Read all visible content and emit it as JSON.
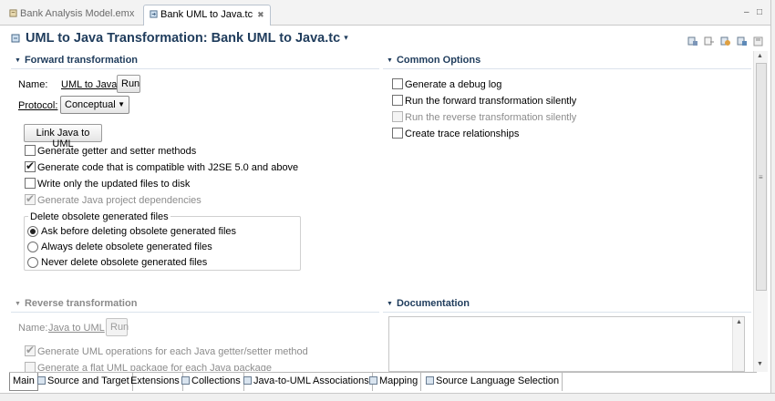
{
  "editor_tabs": [
    {
      "label": "Bank Analysis Model.emx",
      "active": false
    },
    {
      "label": "Bank UML to Java.tc",
      "active": true,
      "close": "✖"
    }
  ],
  "window_controls": {
    "minimize": "‒",
    "maximize": "□"
  },
  "header": {
    "title": "UML to Java Transformation: Bank UML to Java.tc",
    "menu_caret": "▾"
  },
  "forward": {
    "title": "Forward transformation",
    "name_label": "Name:",
    "name_value": "UML to Java",
    "run_label": "Run",
    "protocol_label": "Protocol:",
    "protocol_value": "Conceptual",
    "link_button": "Link Java to UML",
    "options": [
      {
        "label": "Generate getter and setter methods",
        "checked": false,
        "enabled": true
      },
      {
        "label": "Generate code that is compatible with J2SE 5.0 and above",
        "checked": true,
        "enabled": true
      },
      {
        "label": "Write only the updated files to disk",
        "checked": false,
        "enabled": true
      },
      {
        "label": "Generate Java project dependencies",
        "checked": true,
        "enabled": false
      }
    ],
    "delete_group": {
      "title": "Delete obsolete generated files",
      "options": [
        {
          "label": "Ask before deleting obsolete generated files",
          "selected": true
        },
        {
          "label": "Always delete obsolete generated files",
          "selected": false
        },
        {
          "label": "Never delete obsolete generated files",
          "selected": false
        }
      ]
    }
  },
  "common": {
    "title": "Common Options",
    "options": [
      {
        "label": "Generate a debug log",
        "checked": false,
        "enabled": true
      },
      {
        "label": "Run the forward transformation silently",
        "checked": false,
        "enabled": true
      },
      {
        "label": "Run the reverse transformation silently",
        "checked": false,
        "enabled": false
      },
      {
        "label": "Create trace relationships",
        "checked": false,
        "enabled": true
      }
    ]
  },
  "reverse": {
    "title": "Reverse transformation",
    "name_label": "Name:",
    "name_value": "Java to UML",
    "run_label": "Run",
    "options": [
      {
        "label": "Generate UML operations for each Java getter/setter method",
        "checked": true,
        "enabled": false
      },
      {
        "label": "Generate a flat UML package for each Java package",
        "checked": false,
        "enabled": false
      }
    ]
  },
  "documentation": {
    "title": "Documentation",
    "value": ""
  },
  "page_tabs": [
    {
      "label": "Main",
      "active": true,
      "icon": false
    },
    {
      "label": "Source and Target",
      "active": false,
      "icon": true
    },
    {
      "label": "Extensions",
      "active": false,
      "icon": false
    },
    {
      "label": "Collections",
      "active": false,
      "icon": true
    },
    {
      "label": "Java-to-UML Associations",
      "active": false,
      "icon": true
    },
    {
      "label": "Mapping",
      "active": false,
      "icon": true
    },
    {
      "label": "Source Language Selection",
      "active": false,
      "icon": true
    }
  ],
  "colors": {
    "title": "#1f3c5c",
    "accent": "#3a6ea5"
  }
}
